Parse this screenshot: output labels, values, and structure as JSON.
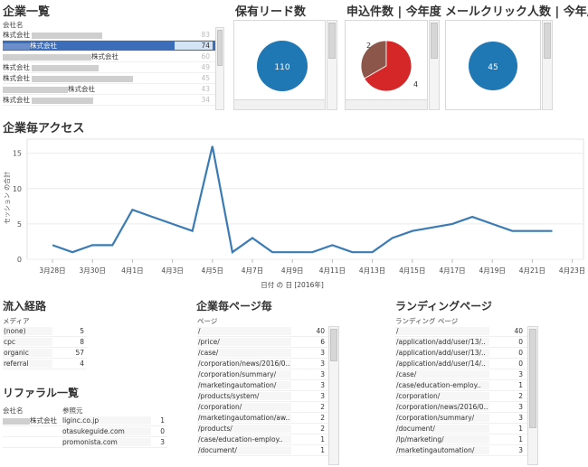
{
  "company_list": {
    "title": "企業一覧",
    "col_header": "会社名",
    "rows": [
      {
        "name": "株式会社",
        "value": "83",
        "selected": false
      },
      {
        "name": "株式会社",
        "value": "74",
        "selected": true
      },
      {
        "name": "株式会社",
        "value": "60",
        "selected": false
      },
      {
        "name": "株式会社",
        "value": "49",
        "selected": false
      },
      {
        "name": "株式会社",
        "value": "45",
        "selected": false
      },
      {
        "name": "株式会社",
        "value": "43",
        "selected": false
      },
      {
        "name": "株式会社",
        "value": "34",
        "selected": false
      }
    ]
  },
  "leads": {
    "title": "保有リード数",
    "value": "110",
    "color": "#1f77b4"
  },
  "applications": {
    "title": "申込件数 | 今年度",
    "label_a": "2",
    "label_b": "4",
    "slices": [
      {
        "value": 2,
        "color": "#8c564b"
      },
      {
        "value": 4,
        "color": "#d62728"
      }
    ]
  },
  "mail_clicks": {
    "title": "メールクリック人数 | 今年度",
    "value": "45",
    "color": "#1f77b4"
  },
  "access": {
    "title": "企業毎アクセス",
    "chart_data": {
      "type": "line",
      "xlabel": "日付 の 日 [2016年]",
      "ylabel": "セッション の合計",
      "ylim": [
        0,
        17
      ],
      "yticks": [
        "0",
        "5",
        "10",
        "15"
      ],
      "xticks": [
        "3月28日",
        "3月30日",
        "4月1日",
        "4月3日",
        "4月5日",
        "4月7日",
        "4月9日",
        "4月11日",
        "4月13日",
        "4月15日",
        "4月17日",
        "4月19日",
        "4月21日",
        "4月23日"
      ],
      "series": [
        {
          "color": "#3a7bb5",
          "points": [
            {
              "day": 0,
              "y": 2
            },
            {
              "day": 1,
              "y": 1
            },
            {
              "day": 2,
              "y": 2
            },
            {
              "day": 3,
              "y": 2
            },
            {
              "day": 4,
              "y": 7
            },
            {
              "day": 5,
              "y": 6
            },
            {
              "day": 6,
              "y": 5
            },
            {
              "day": 7,
              "y": 4
            },
            {
              "day": 8,
              "y": 16
            },
            {
              "day": 9,
              "y": 1
            },
            {
              "day": 10,
              "y": 3
            },
            {
              "day": 11,
              "y": 1
            },
            {
              "day": 12,
              "y": 1
            },
            {
              "day": 13,
              "y": 1
            },
            {
              "day": 14,
              "y": 2
            },
            {
              "day": 15,
              "y": 1
            },
            {
              "day": 16,
              "y": 1
            },
            {
              "day": 17,
              "y": 3
            },
            {
              "day": 18,
              "y": 4
            },
            {
              "day": 20,
              "y": 5
            },
            {
              "day": 21,
              "y": 6
            },
            {
              "day": 22,
              "y": 5
            },
            {
              "day": 23,
              "y": 4
            },
            {
              "day": 24,
              "y": 4
            },
            {
              "day": 25,
              "y": 4
            }
          ]
        }
      ]
    }
  },
  "inflow": {
    "title": "流入経路",
    "col_header": "メディア",
    "rows": [
      {
        "name": "(none)",
        "value": "5"
      },
      {
        "name": "cpc",
        "value": "8"
      },
      {
        "name": "organic",
        "value": "57"
      },
      {
        "name": "referral",
        "value": "4"
      }
    ]
  },
  "referral": {
    "title": "リファラル一覧",
    "col1": "会社名",
    "col2": "参照元",
    "rows": [
      {
        "company": "株式会社",
        "source": "liginc.co.jp",
        "value": "1"
      },
      {
        "company": "",
        "source": "otasukeguide.com",
        "value": "0"
      },
      {
        "company": "",
        "source": "promonista.com",
        "value": "3"
      }
    ]
  },
  "pages": {
    "title": "企業毎ページ毎",
    "col_header": "ページ",
    "rows": [
      {
        "name": "/",
        "value": "40"
      },
      {
        "name": "/price/",
        "value": "6"
      },
      {
        "name": "/case/",
        "value": "3"
      },
      {
        "name": "/corporation/news/2016/0..",
        "value": "3"
      },
      {
        "name": "/corporation/summary/",
        "value": "3"
      },
      {
        "name": "/marketingautomation/",
        "value": "3"
      },
      {
        "name": "/products/system/",
        "value": "3"
      },
      {
        "name": "/corporation/",
        "value": "2"
      },
      {
        "name": "/marketingautomation/aw..",
        "value": "2"
      },
      {
        "name": "/products/",
        "value": "2"
      },
      {
        "name": "/case/education-employ..",
        "value": "1"
      },
      {
        "name": "/document/",
        "value": "1"
      }
    ]
  },
  "landing": {
    "title": "ランディングページ",
    "col_header": "ランディング ページ",
    "rows": [
      {
        "name": "/",
        "value": "40"
      },
      {
        "name": "/application/add/user/13/..",
        "value": "0"
      },
      {
        "name": "/application/add/user/13/..",
        "value": "0"
      },
      {
        "name": "/application/add/user/14/..",
        "value": "0"
      },
      {
        "name": "/case/",
        "value": "3"
      },
      {
        "name": "/case/education-employ..",
        "value": "1"
      },
      {
        "name": "/corporation/",
        "value": "2"
      },
      {
        "name": "/corporation/news/2016/0..",
        "value": "3"
      },
      {
        "name": "/corporation/summary/",
        "value": "3"
      },
      {
        "name": "/document/",
        "value": "1"
      },
      {
        "name": "/lp/marketing/",
        "value": "1"
      },
      {
        "name": "/marketingautomation/",
        "value": "3"
      }
    ]
  }
}
